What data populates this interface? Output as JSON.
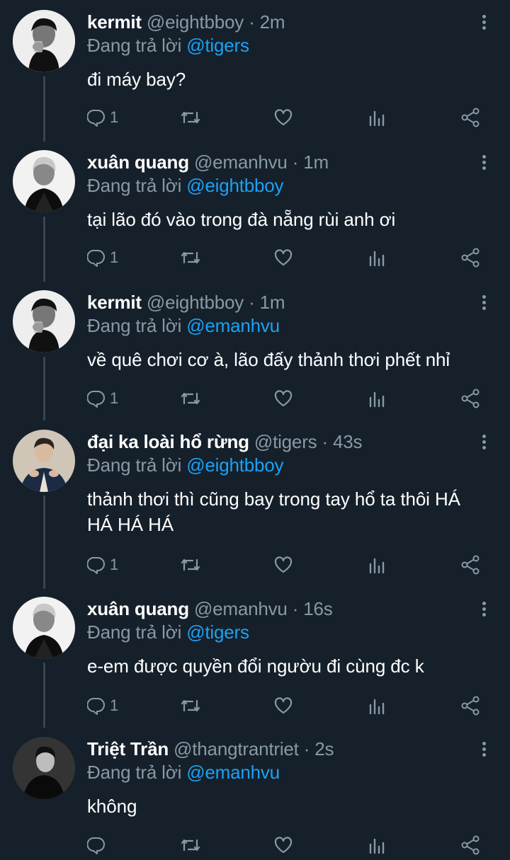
{
  "reply_prefix": "Đang trả lời",
  "tweets": [
    {
      "name": "kermit",
      "handle": "@eightbboy",
      "time": "2m",
      "reply_to": "@tigers",
      "text": "đi máy bay?",
      "reply_count": "1",
      "avatar": "kermit-avatar"
    },
    {
      "name": "xuân quang",
      "handle": "@emanhvu",
      "time": "1m",
      "reply_to": "@eightbboy",
      "text": "tại lão đó vào trong đà nẵng rùi anh ơi",
      "reply_count": "1",
      "avatar": "xuan-quang-avatar"
    },
    {
      "name": "kermit",
      "handle": "@eightbboy",
      "time": "1m",
      "reply_to": "@emanhvu",
      "text": "về quê chơi cơ à, lão đấy thảnh thơi phết nhỉ",
      "reply_count": "1",
      "avatar": "kermit-avatar"
    },
    {
      "name": "đại ka loài hổ rừng",
      "handle": "@tigers",
      "time": "43s",
      "reply_to": "@eightbboy",
      "text": "thảnh thơi thì cũng bay trong tay hổ ta thôi HÁ HÁ HÁ HÁ",
      "reply_count": "1",
      "avatar": "tigers-avatar"
    },
    {
      "name": "xuân quang",
      "handle": "@emanhvu",
      "time": "16s",
      "reply_to": "@tigers",
      "text": "e-em được quyền đổi ngườu đi cùng đc k",
      "reply_count": "1",
      "avatar": "xuan-quang-avatar"
    },
    {
      "name": "Triệt Trần",
      "handle": "@thangtrantriet",
      "time": "2s",
      "reply_to": "@emanhvu",
      "text": "không",
      "reply_count": "",
      "avatar": "triet-tran-avatar"
    }
  ],
  "colors": {
    "background": "#15202b",
    "secondary_text": "#8899a6",
    "link": "#1da1f2",
    "thread_line": "#38444d"
  },
  "icons": [
    "reply-icon",
    "retweet-icon",
    "like-icon",
    "stats-icon",
    "share-icon",
    "more-icon"
  ]
}
